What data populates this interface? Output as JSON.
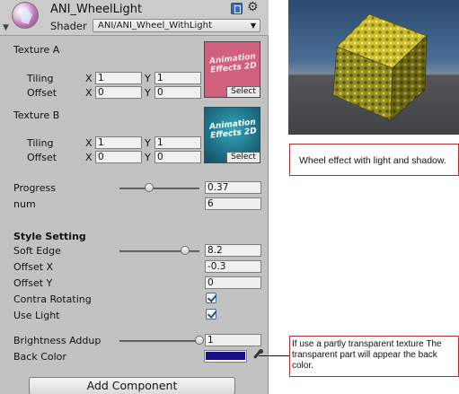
{
  "header": {
    "material_name": "ANI_WheelLight",
    "shader_label": "Shader",
    "shader_value": "ANI/ANI_Wheel_WithLight"
  },
  "texture_a": {
    "label": "Texture A",
    "tiling_label": "Tiling",
    "offset_label": "Offset",
    "x_label": "X",
    "y_label": "Y",
    "tiling_x": "1",
    "tiling_y": "1",
    "offset_x": "0",
    "offset_y": "0",
    "thumb_text": "Animation Effects 2D",
    "select_label": "Select"
  },
  "texture_b": {
    "label": "Texture B",
    "tiling_label": "Tiling",
    "offset_label": "Offset",
    "x_label": "X",
    "y_label": "Y",
    "tiling_x": "1",
    "tiling_y": "1",
    "offset_x": "0",
    "offset_y": "0",
    "thumb_text": "Animation Effects 2D",
    "select_label": "Select"
  },
  "properties": {
    "progress_label": "Progress",
    "progress_value": "0.37",
    "progress_slider": 0.37,
    "num_label": "num",
    "num_value": "6"
  },
  "style_setting": {
    "section_title": "Style Setting",
    "soft_edge_label": "Soft Edge",
    "soft_edge_value": "8.2",
    "soft_edge_slider": 0.82,
    "offset_x_label": "Offset X",
    "offset_x_value": "-0.3",
    "offset_y_label": "Offset Y",
    "offset_y_value": "0",
    "contra_rotating_label": "Contra Rotating",
    "contra_rotating_checked": true,
    "use_light_label": "Use Light",
    "use_light_checked": true,
    "brightness_label": "Brightness Addup",
    "brightness_value": "1",
    "brightness_slider": 1.0,
    "back_color_label": "Back Color",
    "back_color_hex": "#1c0f86"
  },
  "footer": {
    "add_component_label": "Add Component"
  },
  "annotations": {
    "preview_note": "Wheel effect with light and shadow.",
    "back_color_note": "If use a partly transparent texture The transparent part will appear the back color."
  },
  "colors": {
    "panel_bg": "#c2c2c2",
    "note_border": "#aa3333"
  },
  "icons": [
    "material-sphere-icon",
    "foldout-arrow-icon",
    "help-book-icon",
    "gear-icon",
    "eyedropper-icon",
    "checkmark-icon"
  ]
}
